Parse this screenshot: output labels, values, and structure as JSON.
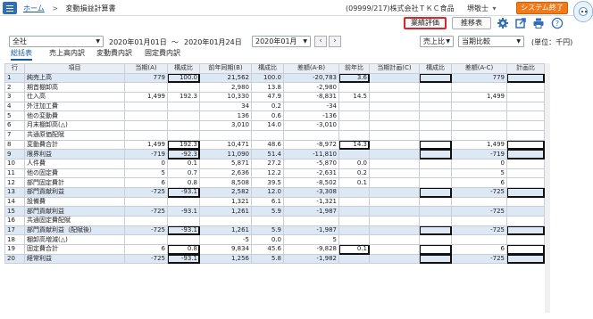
{
  "header": {
    "home_link": "ホーム",
    "separator": ">",
    "page_title": "変動損益計算書",
    "company": "(09999/217)株式会社ＴＫＣ食品",
    "user": "堺敬士",
    "user_caret": "▾",
    "exit_label": "システム終了"
  },
  "toolbar": {
    "performance_label": "業績評価",
    "trend_label": "推移表",
    "icons": [
      "gear-icon",
      "export-icon",
      "print-icon",
      "help-icon"
    ]
  },
  "filters": {
    "scope": "全社",
    "date_from": "2020年01月01日",
    "tilde": "〜",
    "date_to": "2020年01月24日",
    "month": "2020年01月",
    "sort": "売上比",
    "compare": "当期比較",
    "unit": "(単位：千円)"
  },
  "tabs": [
    "総括表",
    "売上高内訳",
    "変動費内訳",
    "固定費内訳"
  ],
  "table": {
    "columns": [
      "行",
      "項目",
      "当期(A)",
      "構成比",
      "前年同期(B)",
      "構成比",
      "差額(A-B)",
      "前年比",
      "当期計画(C)",
      "構成比",
      "差額(A-C)",
      "計画比"
    ],
    "rows": [
      {
        "no": "1",
        "label": "純売上高",
        "a": "779",
        "r1": "100.0",
        "b": "21,562",
        "r2": "100.0",
        "d": "-20,783",
        "py": "3.6",
        "c": "",
        "r3": "",
        "dc": "779",
        "pr": "",
        "hl": true
      },
      {
        "no": "2",
        "label": "期首棚卸高",
        "a": "",
        "r1": "",
        "b": "2,980",
        "r2": "13.8",
        "d": "-2,980",
        "py": "",
        "c": "",
        "r3": "",
        "dc": "",
        "pr": "",
        "hl": false
      },
      {
        "no": "3",
        "label": "仕入高",
        "a": "1,499",
        "r1": "192.3",
        "b": "10,330",
        "r2": "47.9",
        "d": "-8,831",
        "py": "14.5",
        "c": "",
        "r3": "",
        "dc": "1,499",
        "pr": "",
        "hl": false
      },
      {
        "no": "4",
        "label": "外注加工費",
        "a": "",
        "r1": "",
        "b": "34",
        "r2": "0.2",
        "d": "-34",
        "py": "",
        "c": "",
        "r3": "",
        "dc": "",
        "pr": "",
        "hl": false
      },
      {
        "no": "5",
        "label": "他の変動費",
        "a": "",
        "r1": "",
        "b": "136",
        "r2": "0.6",
        "d": "-136",
        "py": "",
        "c": "",
        "r3": "",
        "dc": "",
        "pr": "",
        "hl": false
      },
      {
        "no": "6",
        "label": "月末棚卸高(△)",
        "a": "",
        "r1": "",
        "b": "3,010",
        "r2": "14.0",
        "d": "-3,010",
        "py": "",
        "c": "",
        "r3": "",
        "dc": "",
        "pr": "",
        "hl": false
      },
      {
        "no": "7",
        "label": "共通原価配賦",
        "a": "",
        "r1": "",
        "b": "",
        "r2": "",
        "d": "",
        "py": "",
        "c": "",
        "r3": "",
        "dc": "",
        "pr": "",
        "hl": false
      },
      {
        "no": "8",
        "label": "変動費合計",
        "a": "1,499",
        "r1": "192.3",
        "b": "10,471",
        "r2": "48.6",
        "d": "-8,972",
        "py": "14.3",
        "c": "",
        "r3": "",
        "dc": "1,499",
        "pr": "",
        "hl": false
      },
      {
        "no": "9",
        "label": "限界利益",
        "a": "-719",
        "r1": "-92.3",
        "b": "11,090",
        "r2": "51.4",
        "d": "-11,810",
        "py": "",
        "c": "",
        "r3": "",
        "dc": "-719",
        "pr": "",
        "hl": true
      },
      {
        "no": "10",
        "label": "人件費",
        "a": "0",
        "r1": "0.1",
        "b": "5,871",
        "r2": "27.2",
        "d": "-5,870",
        "py": "0.0",
        "c": "",
        "r3": "",
        "dc": "0",
        "pr": "",
        "hl": false
      },
      {
        "no": "11",
        "label": "他の固定費",
        "a": "5",
        "r1": "0.7",
        "b": "2,636",
        "r2": "12.2",
        "d": "-2,631",
        "py": "0.2",
        "c": "",
        "r3": "",
        "dc": "5",
        "pr": "",
        "hl": false
      },
      {
        "no": "12",
        "label": "部門固定費計",
        "a": "6",
        "r1": "0.8",
        "b": "8,508",
        "r2": "39.5",
        "d": "-8,502",
        "py": "0.1",
        "c": "",
        "r3": "",
        "dc": "6",
        "pr": "",
        "hl": false
      },
      {
        "no": "13",
        "label": "部門貢献利益",
        "a": "-725",
        "r1": "-93.1",
        "b": "2,582",
        "r2": "12.0",
        "d": "-3,308",
        "py": "",
        "c": "",
        "r3": "",
        "dc": "-725",
        "pr": "",
        "hl": true
      },
      {
        "no": "14",
        "label": "設備費",
        "a": "",
        "r1": "",
        "b": "1,321",
        "r2": "6.1",
        "d": "-1,321",
        "py": "",
        "c": "",
        "r3": "",
        "dc": "",
        "pr": "",
        "hl": false
      },
      {
        "no": "15",
        "label": "部門貢献利益",
        "a": "-725",
        "r1": "-93.1",
        "b": "1,261",
        "r2": "5.9",
        "d": "-1,987",
        "py": "",
        "c": "",
        "r3": "",
        "dc": "-725",
        "pr": "",
        "hl": true
      },
      {
        "no": "16",
        "label": "共通固定費配賦",
        "a": "",
        "r1": "",
        "b": "",
        "r2": "",
        "d": "",
        "py": "",
        "c": "",
        "r3": "",
        "dc": "",
        "pr": "",
        "hl": false
      },
      {
        "no": "17",
        "label": "部門貢献利益（配賦後）",
        "a": "-725",
        "r1": "-93.1",
        "b": "1,261",
        "r2": "5.9",
        "d": "-1,987",
        "py": "",
        "c": "",
        "r3": "",
        "dc": "-725",
        "pr": "",
        "hl": true
      },
      {
        "no": "18",
        "label": "棚卸高増減(△)",
        "a": "",
        "r1": "",
        "b": "-5",
        "r2": "0.0",
        "d": "5",
        "py": "",
        "c": "",
        "r3": "",
        "dc": "",
        "pr": "",
        "hl": false
      },
      {
        "no": "19",
        "label": "固定費合計",
        "a": "6",
        "r1": "0.8",
        "b": "9,834",
        "r2": "45.6",
        "d": "-9,828",
        "py": "0.1",
        "c": "",
        "r3": "",
        "dc": "6",
        "pr": "",
        "hl": false
      },
      {
        "no": "20",
        "label": "経常利益",
        "a": "-725",
        "r1": "-93.1",
        "b": "1,256",
        "r2": "5.8",
        "d": "-1,982",
        "py": "",
        "c": "",
        "r3": "",
        "dc": "-725",
        "pr": "",
        "hl": true
      }
    ]
  }
}
